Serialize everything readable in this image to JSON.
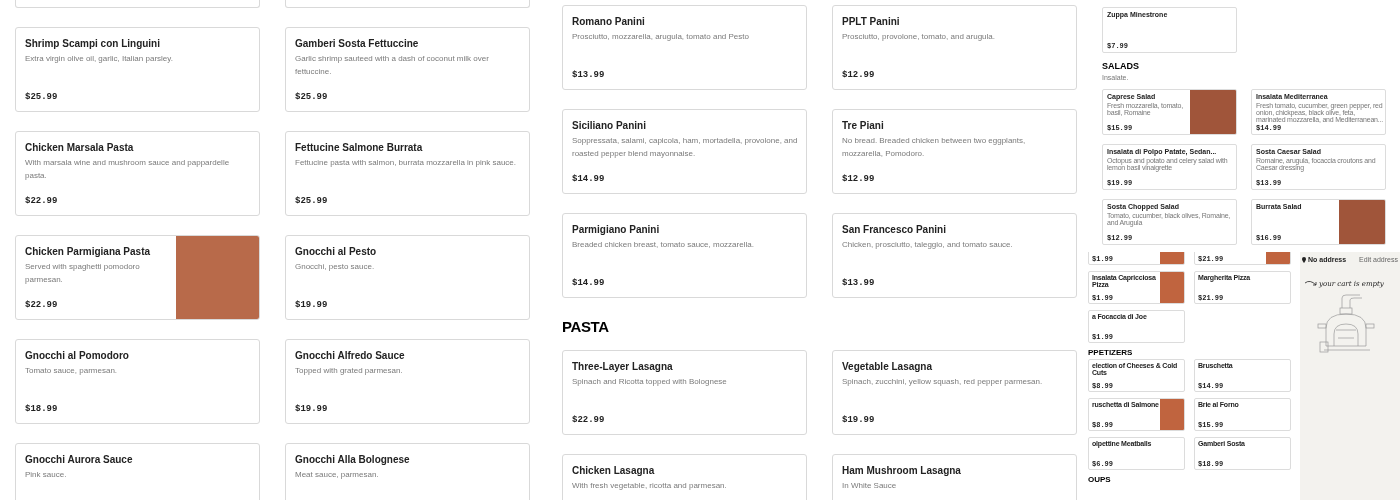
{
  "panels": [
    {
      "blocks": [
        {
          "kind": "row",
          "cards": [
            {
              "name": "Shrimp Scampi con Linguini",
              "description": "Extra virgin olive oil, garlic, Italian parsley.",
              "price": "$25.99",
              "photo": false
            },
            {
              "name": "Gamberi Sosta Fettuccine",
              "description": "Garlic shrimp sauteed with a dash of coconut milk over fettuccine.",
              "price": "$25.99",
              "photo": false
            }
          ]
        },
        {
          "kind": "row",
          "cards": [
            {
              "name": "Chicken Marsala Pasta",
              "description": "With marsala wine and mushroom sauce and pappardelle pasta.",
              "price": "$22.99",
              "photo": false
            },
            {
              "name": "Fettucine Salmone Burrata",
              "description": "Fettucine pasta with salmon, burrata mozzarella in pink sauce.",
              "price": "$25.99",
              "photo": false
            }
          ]
        },
        {
          "kind": "row",
          "cards": [
            {
              "name": "Chicken Parmigiana Pasta",
              "description": "Served with spaghetti pomodoro parmesan.",
              "price": "$22.99",
              "photo": true
            },
            {
              "name": "Gnocchi al Pesto",
              "description": "Gnocchi, pesto sauce.",
              "price": "$19.99",
              "photo": false
            }
          ]
        },
        {
          "kind": "row",
          "cards": [
            {
              "name": "Gnocchi al Pomodoro",
              "description": "Tomato sauce, parmesan.",
              "price": "$18.99",
              "photo": false
            },
            {
              "name": "Gnocchi Alfredo Sauce",
              "description": "Topped with grated parmesan.",
              "price": "$19.99",
              "photo": false
            }
          ]
        },
        {
          "kind": "row",
          "cards": [
            {
              "name": "Gnocchi Aurora Sauce",
              "description": "Pink sauce.",
              "photo": false
            },
            {
              "name": "Gnocchi Alla Bolognese",
              "description": "Meat sauce, parmesan.",
              "photo": false
            }
          ]
        }
      ]
    },
    {
      "blocks": [
        {
          "kind": "row",
          "cards": [
            {
              "name": "Romano Panini",
              "description": "Prosciutto, mozzarella, arugula, tomato and Pesto",
              "price": "$13.99",
              "photo": false
            },
            {
              "name": "PPLT Panini",
              "description": "Prosciutto, provolone, tomato, and arugula.",
              "price": "$12.99",
              "photo": false
            }
          ]
        },
        {
          "kind": "row",
          "cards": [
            {
              "name": "Siciliano Panini",
              "description": "Soppressata, salami, capicola, ham, mortadella, provolone, and roasted pepper blend mayonnaise.",
              "price": "$14.99",
              "photo": false
            },
            {
              "name": "Tre Piani",
              "description": "No bread. Breaded chicken between two eggplants, mozzarella, Pomodoro.",
              "price": "$12.99",
              "photo": false
            }
          ]
        },
        {
          "kind": "row",
          "cards": [
            {
              "name": "Parmigiano Panini",
              "description": "Breaded chicken breast, tomato sauce, mozzarella.",
              "price": "$14.99",
              "photo": false
            },
            {
              "name": "San Francesco Panini",
              "description": "Chicken, prosciutto, taleggio, and tomato sauce.",
              "price": "$13.99",
              "photo": false
            }
          ]
        },
        {
          "kind": "heading",
          "text": "PASTA"
        },
        {
          "kind": "row",
          "cards": [
            {
              "name": "Three-Layer Lasagna",
              "description": "Spinach and Ricotta topped with Bolognese",
              "price": "$22.99",
              "photo": false
            },
            {
              "name": "Vegetable Lasagna",
              "description": "Spinach, zucchini, yellow squash, red pepper parmesan.",
              "price": "$19.99",
              "photo": false
            }
          ]
        },
        {
          "kind": "row",
          "cards": [
            {
              "name": "Chicken Lasagna",
              "description": "With fresh vegetable, ricotta and parmesan.",
              "photo": false
            },
            {
              "name": "Ham Mushroom Lasagna",
              "description": "In White Sauce",
              "photo": false
            }
          ]
        }
      ]
    },
    {
      "blocks": [
        {
          "kind": "row",
          "cards": [
            {
              "name": "Zuppa Minestrone",
              "price": "$7.99",
              "photo": false
            }
          ]
        },
        {
          "kind": "heading",
          "text": "SALADS"
        },
        {
          "kind": "note",
          "text": "Insalate."
        },
        {
          "kind": "row",
          "cards": [
            {
              "name": "Caprese Salad",
              "description": "Fresh mozzarella, tomato, basil, Romaine",
              "price": "$15.99",
              "photo": true
            },
            {
              "name": "Insalata Mediterranea",
              "description": "Fresh tomato, cucumber, green pepper, red onion, chickpeas, black olive, feta, marinated mozzarella, and Mediterranean...",
              "price": "$14.99",
              "photo": false
            }
          ]
        },
        {
          "kind": "row",
          "cards": [
            {
              "name": "Insalata di Polpo Patate, Sedan...",
              "description": "Octopus and potato and celery salad with lemon basil vinaigrette",
              "price": "$19.99",
              "photo": false
            },
            {
              "name": "Sosta Caesar Salad",
              "description": "Romaine, arugula, focaccia croutons and Caesar dressing",
              "price": "$13.99",
              "photo": false
            }
          ]
        },
        {
          "kind": "row",
          "cards": [
            {
              "name": "Sosta Chopped Salad",
              "description": "Tomato, cucumber, black olives, Romaine, and Arugula",
              "price": "$12.99",
              "photo": false
            },
            {
              "name": "Burrata Salad",
              "price": "$16.99",
              "photo": true
            }
          ]
        }
      ]
    },
    {
      "blocks": [
        {
          "kind": "row",
          "cards": [
            {
              "price": "$1.99",
              "photo": true
            },
            {
              "price": "$21.99",
              "photo": true
            }
          ]
        },
        {
          "kind": "row",
          "cards": [
            {
              "name": "Insalata Capricciosa Pizza",
              "price": "$1.99",
              "photo": true
            },
            {
              "name": "Margherita Pizza",
              "price": "$21.99",
              "photo": false
            }
          ]
        },
        {
          "kind": "row",
          "cards": [
            {
              "name": "a Focaccia di Joe",
              "price": "$1.99",
              "photo": false
            }
          ]
        },
        {
          "kind": "heading",
          "text": "PPETIZERS"
        },
        {
          "kind": "row",
          "cards": [
            {
              "name": "election of Cheeses & Cold Cuts",
              "price": "$8.99",
              "photo": false
            },
            {
              "name": "Bruschetta",
              "price": "$14.99",
              "photo": false
            }
          ]
        },
        {
          "kind": "row",
          "cards": [
            {
              "name": "ruschetta di Salmone",
              "price": "$8.99",
              "photo": true
            },
            {
              "name": "Brie al Forno",
              "price": "$15.99",
              "photo": false
            }
          ]
        },
        {
          "kind": "row",
          "cards": [
            {
              "name": "olpettine Meatballs",
              "price": "$6.99",
              "photo": false
            },
            {
              "name": "Gamberi Sosta",
              "price": "$18.99",
              "photo": false
            }
          ]
        },
        {
          "kind": "heading",
          "text": "OUPS"
        }
      ],
      "cart": {
        "address": "No address",
        "edit_label": "Edit address",
        "message": "your cart is empty"
      }
    }
  ]
}
